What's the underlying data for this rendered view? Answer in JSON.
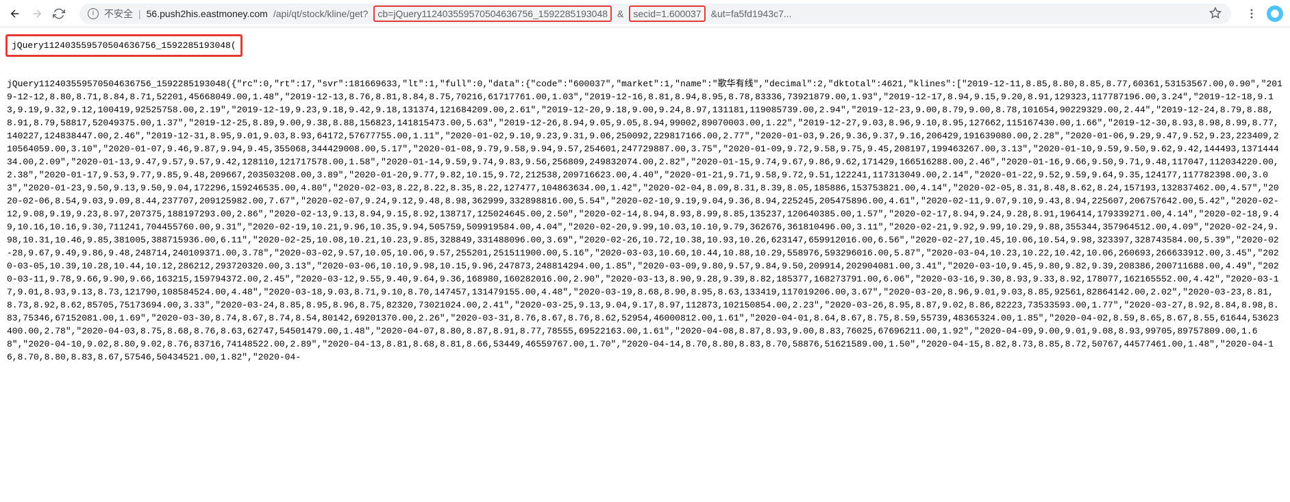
{
  "toolbar": {
    "insecure_label": "不安全",
    "url_host": "56.push2his.eastmoney.com",
    "url_path_pre": "/api/qt/stock/kline/get?",
    "url_cb": "cb=jQuery112403559570504636756_1592285193048",
    "url_secid": "secid=1.600037",
    "url_rest": "&ut=fa5fd1943c7...",
    "amp": "&"
  },
  "callback_box": "jQuery112403559570504636756_1592285193048(",
  "response_body": "jQuery112403559570504636756_1592285193048({\"rc\":0,\"rt\":17,\"svr\":181669633,\"lt\":1,\"full\":0,\"data\":{\"code\":\"600037\",\"market\":1,\"name\":\"歌华有线\",\"decimal\":2,\"dktotal\":4621,\"klines\":[\"2019-12-11,8.85,8.80,8.85,8.77,60361,53153567.00,0.90\",\"2019-12-12,8.80,8.71,8.84,8.71,52201,45668049.00,1.48\",\"2019-12-13,8.76,8.81,8.84,8.75,70216,61717761.00,1.03\",\"2019-12-16,8.81,8.94,8.95,8.78,83336,73921879.00,1.93\",\"2019-12-17,8.94,9.15,9.20,8.91,129323,117787196.00,3.24\",\"2019-12-18,9.13,9.19,9.32,9.12,100419,92525758.00,2.19\",\"2019-12-19,9.23,9.18,9.42,9.18,131374,121684209.00,2.61\",\"2019-12-20,9.18,9.00,9.24,8.97,131181,119085739.00,2.94\",\"2019-12-23,9.00,8.79,9.00,8.78,101654,90229329.00,2.44\",\"2019-12-24,8.79,8.88,8.91,8.79,58817,52049375.00,1.37\",\"2019-12-25,8.89,9.00,9.38,8.88,156823,141815473.00,5.63\",\"2019-12-26,8.94,9.05,9.05,8.94,99002,89070003.00,1.22\",\"2019-12-27,9.03,8.96,9.10,8.95,127662,115167430.00,1.66\",\"2019-12-30,8.93,8.98,8.99,8.77,140227,124838447.00,2.46\",\"2019-12-31,8.95,9.01,9.03,8.93,64172,57677755.00,1.11\",\"2020-01-02,9.10,9.23,9.31,9.06,250092,229817166.00,2.77\",\"2020-01-03,9.26,9.36,9.37,9.16,206429,191639080.00,2.28\",\"2020-01-06,9.29,9.47,9.52,9.23,223409,210564059.00,3.10\",\"2020-01-07,9.46,9.87,9.94,9.45,355068,344429008.00,5.17\",\"2020-01-08,9.79,9.58,9.94,9.57,254601,247729887.00,3.75\",\"2020-01-09,9.72,9.58,9.75,9.45,208197,199463267.00,3.13\",\"2020-01-10,9.59,9.50,9.62,9.42,144493,137144434.00,2.09\",\"2020-01-13,9.47,9.57,9.57,9.42,128110,121717578.00,1.58\",\"2020-01-14,9.59,9.74,9.83,9.56,256809,249832074.00,2.82\",\"2020-01-15,9.74,9.67,9.86,9.62,171429,166516288.00,2.46\",\"2020-01-16,9.66,9.50,9.71,9.48,117047,112034220.00,2.38\",\"2020-01-17,9.53,9.77,9.85,9.48,209667,203503208.00,3.89\",\"2020-01-20,9.77,9.82,10.15,9.72,212538,209716623.00,4.40\",\"2020-01-21,9.71,9.58,9.72,9.51,122241,117313049.00,2.14\",\"2020-01-22,9.52,9.59,9.64,9.35,124177,117782398.00,3.03\",\"2020-01-23,9.50,9.13,9.50,9.04,172296,159246535.00,4.80\",\"2020-02-03,8.22,8.22,8.35,8.22,127477,104863634.00,1.42\",\"2020-02-04,8.09,8.31,8.39,8.05,185886,153753821.00,4.14\",\"2020-02-05,8.31,8.48,8.62,8.24,157193,132837462.00,4.57\",\"2020-02-06,8.54,9.03,9.09,8.44,237707,209125982.00,7.67\",\"2020-02-07,9.24,9.12,9.48,8.98,362999,332898816.00,5.54\",\"2020-02-10,9.19,9.04,9.36,8.94,225245,205475896.00,4.61\",\"2020-02-11,9.07,9.10,9.43,8.94,225607,206757642.00,5.42\",\"2020-02-12,9.08,9.19,9.23,8.97,207375,188197293.00,2.86\",\"2020-02-13,9.13,8.94,9.15,8.92,138717,125024645.00,2.50\",\"2020-02-14,8.94,8.93,8.99,8.85,135237,120640385.00,1.57\",\"2020-02-17,8.94,9.24,9.28,8.91,196414,179339271.00,4.14\",\"2020-02-18,9.49,10.16,10.16,9.30,711241,704455760.00,9.31\",\"2020-02-19,10.21,9.96,10.35,9.94,505759,509919584.00,4.04\",\"2020-02-20,9.99,10.03,10.10,9.79,362676,361810496.00,3.11\",\"2020-02-21,9.92,9.99,10.29,9.88,355344,357964512.00,4.09\",\"2020-02-24,9.98,10.31,10.46,9.85,381005,388715936.00,6.11\",\"2020-02-25,10.08,10.21,10.23,9.85,328849,331488096.00,3.69\",\"2020-02-26,10.72,10.38,10.93,10.26,623147,659912016.00,6.56\",\"2020-02-27,10.45,10.06,10.54,9.98,323397,328743584.00,5.39\",\"2020-02-28,9.67,9.49,9.86,9.48,248714,240109371.00,3.78\",\"2020-03-02,9.57,10.05,10.06,9.57,255201,251511900.00,5.16\",\"2020-03-03,10.60,10.44,10.88,10.29,558976,593296016.00,5.87\",\"2020-03-04,10.23,10.22,10.42,10.06,260693,266633912.00,3.45\",\"2020-03-05,10.39,10.28,10.44,10.12,286212,293720320.00,3.13\",\"2020-03-06,10.10,9.98,10.15,9.96,247873,248814294.00,1.85\",\"2020-03-09,9.80,9.57,9.84,9.50,209914,202904081.00,3.41\",\"2020-03-10,9.45,9.80,9.82,9.39,208386,200711688.00,4.49\",\"2020-03-11,9.78,9.66,9.90,9.66,163215,159794372.00,2.45\",\"2020-03-12,9.55,9.40,9.64,9.36,168980,160282016.00,2.90\",\"2020-03-13,8.90,9.28,9.39,8.82,185377,168273791.00,6.06\",\"2020-03-16,9.30,8.93,9.33,8.92,178077,162165552.00,4.42\",\"2020-03-17,9.01,8.93,9.13,8.73,121790,108584524.00,4.48\",\"2020-03-18,9.03,8.71,9.10,8.70,147457,131479155.00,4.48\",\"2020-03-19,8.68,8.90,8.95,8.63,133419,117019206.00,3.67\",\"2020-03-20,8.96,9.01,9.03,8.85,92561,82864142.00,2.02\",\"2020-03-23,8.81,8.73,8.92,8.62,85705,75173694.00,3.33\",\"2020-03-24,8.85,8.95,8.96,8.75,82320,73021024.00,2.41\",\"2020-03-25,9.13,9.04,9.17,8.97,112873,102150854.00,2.23\",\"2020-03-26,8.95,8.87,9.02,8.86,82223,73533593.00,1.77\",\"2020-03-27,8.92,8.84,8.98,8.83,75346,67152081.00,1.69\",\"2020-03-30,8.74,8.67,8.74,8.54,80142,69201370.00,2.26\",\"2020-03-31,8.76,8.67,8.76,8.62,52954,46000812.00,1.61\",\"2020-04-01,8.64,8.67,8.75,8.59,55739,48365324.00,1.85\",\"2020-04-02,8.59,8.65,8.67,8.55,61644,53623400.00,2.78\",\"2020-04-03,8.75,8.68,8.76,8.63,62747,54501479.00,1.48\",\"2020-04-07,8.80,8.87,8.91,8.77,78555,69522163.00,1.61\",\"2020-04-08,8.87,8.93,9.00,8.83,76025,67696211.00,1.92\",\"2020-04-09,9.00,9.01,9.08,8.93,99705,89757809.00,1.68\",\"2020-04-10,9.02,8.80,9.02,8.76,83716,74148522.00,2.89\",\"2020-04-13,8.81,8.68,8.81,8.66,53449,46559767.00,1.70\",\"2020-04-14,8.70,8.80,8.83,8.70,58876,51621589.00,1.50\",\"2020-04-15,8.82,8.73,8.85,8.72,50767,44577461.00,1.48\",\"2020-04-16,8.70,8.80,8.83,8.67,57546,50434521.00,1.82\",\"2020-04-"
}
